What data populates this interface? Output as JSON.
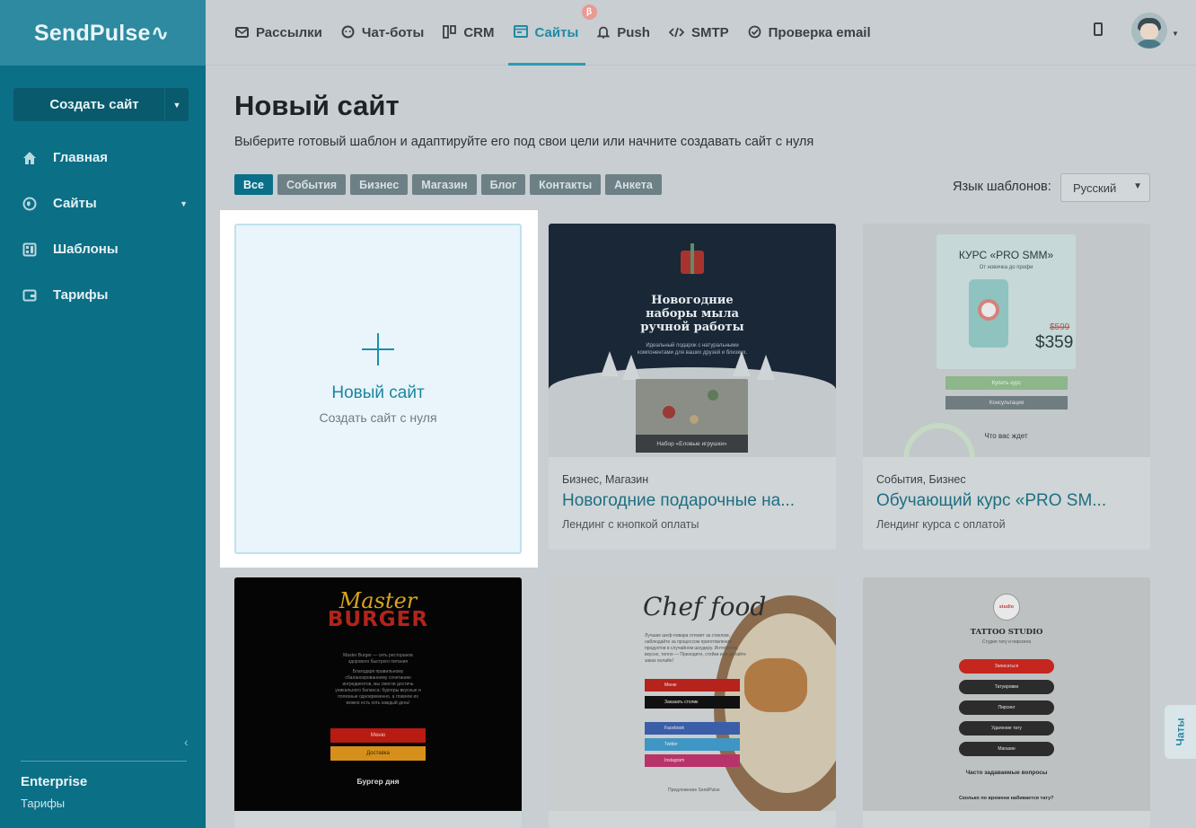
{
  "brand": {
    "logo_text": "SendPulse"
  },
  "sidebar": {
    "create_button": "Создать сайт",
    "items": [
      {
        "label": "Главная",
        "icon": "home-icon"
      },
      {
        "label": "Сайты",
        "icon": "globe-icon"
      },
      {
        "label": "Шаблоны",
        "icon": "template-icon"
      },
      {
        "label": "Тарифы",
        "icon": "wallet-icon"
      }
    ],
    "plan_name": "Enterprise",
    "plan_link": "Тарифы"
  },
  "topnav": {
    "tabs": [
      {
        "label": "Рассылки",
        "icon": "mail-icon"
      },
      {
        "label": "Чат-боты",
        "icon": "chat-bot-icon"
      },
      {
        "label": "CRM",
        "icon": "crm-icon"
      },
      {
        "label": "Сайты",
        "icon": "sites-icon",
        "active": true
      },
      {
        "label": "Push",
        "icon": "bell-icon"
      },
      {
        "label": "SMTP",
        "icon": "code-icon"
      },
      {
        "label": "Проверка email",
        "icon": "check-circle-icon"
      }
    ],
    "beta_badge": "β"
  },
  "main": {
    "title": "Новый сайт",
    "subtitle": "Выберите готовый шаблон и адаптируйте его под свои цели или начните создавать сайт с нуля",
    "filters": [
      "Все",
      "События",
      "Бизнес",
      "Магазин",
      "Блог",
      "Контакты",
      "Анкета"
    ],
    "lang_label": "Язык шаблонов:",
    "lang_value": "Русский",
    "new_card": {
      "title": "Новый сайт",
      "subtitle": "Создать сайт с нуля"
    },
    "cards": [
      {
        "category": "Бизнес, Магазин",
        "title": "Новогодние подарочные на...",
        "desc": "Лендинг с кнопкой оплаты",
        "thumb": {
          "h1": "Новогодние",
          "h2": "наборы мыла",
          "h3": "ручной работы",
          "p": "Идеальный подарок с натуральными компонентами для ваших друзей и близких.",
          "bar": "Набор «Еловые игрушки»"
        }
      },
      {
        "category": "События, Бизнес",
        "title": "Обучающий курс «PRO SM...",
        "desc": "Лендинг курса с оплатой",
        "thumb": {
          "title": "КУРС «PRO SMM»",
          "sub": "От новичка до профи",
          "old": "$599",
          "price": "$359",
          "b1": "Купить курс",
          "b2": "Консультация",
          "wait": "Что вас ждет"
        }
      }
    ],
    "thumbs_row2": {
      "burger": {
        "m1": "Master",
        "m2": "BURGER",
        "p1": "Master Burger — сеть ресторанов здорового быстрого питания",
        "p2": "Благодаря правильному сбалансированному сочетанию ингредиентов, мы смогли достичь уникального баланса: бургеры вкусные и полезные одновременно, а главное их можно есть хоть каждый день!",
        "b1": "Меню",
        "b2": "Доставка",
        "bd": "Бургер дня"
      },
      "chef": {
        "title": "Chef food",
        "p": "Лучшие шеф-повара готовят за стеклом, наблюдайте за процессом приготовления продуктов в случайном шоудеру. Интересно, вкусно, тепло — Приходите, стейки или делайте заказ онлайн!",
        "b1": "Меню",
        "b2": "Заказать столик",
        "b3": "Facebook",
        "b4": "Twitter",
        "b5": "Instagram",
        "foot": "Предложение SendPulse"
      },
      "tattoo": {
        "logo": "studio",
        "title": "TATTOO STUDIO",
        "sub": "Студия тату и пирсинга",
        "p1": "Записаться",
        "p2": "Татуировки",
        "p3": "Пирсинг",
        "p4": "Удаление тату",
        "p5": "Магазин",
        "q": "Часто задаваемые вопросы",
        "q2": "Сколько по времени набивается тату?"
      }
    }
  },
  "chat_tab": "Чаты"
}
